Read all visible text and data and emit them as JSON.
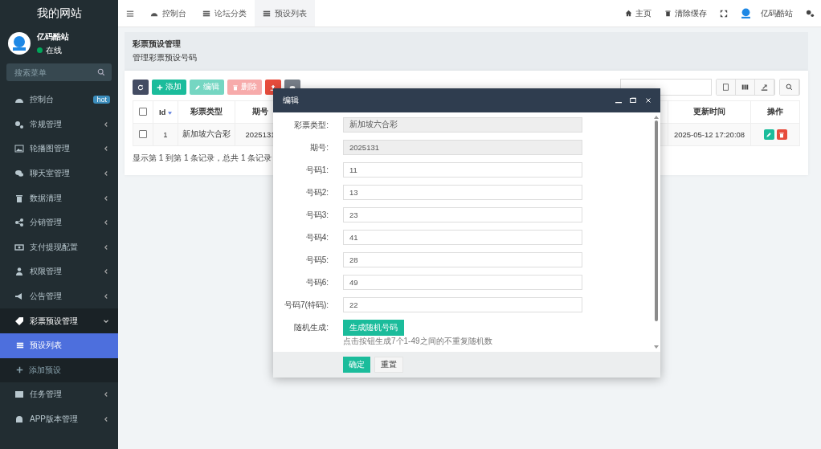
{
  "sidebar": {
    "title": "我的网站",
    "user": {
      "name": "亿码酷站",
      "status": "在线",
      "online": true
    },
    "search": {
      "placeholder": "搜索菜单"
    },
    "items": [
      {
        "label": "控制台",
        "badge": "hot",
        "expanded": false
      },
      {
        "label": "常规管理",
        "expanded": false
      },
      {
        "label": "轮播图管理",
        "expanded": false
      },
      {
        "label": "聊天室管理",
        "expanded": false
      },
      {
        "label": "数据清理",
        "expanded": false
      },
      {
        "label": "分销管理",
        "expanded": false
      },
      {
        "label": "支付提现配置",
        "expanded": false
      },
      {
        "label": "权限管理",
        "expanded": false
      },
      {
        "label": "公告管理",
        "expanded": false
      },
      {
        "label": "彩票预设管理",
        "expanded": true,
        "children": [
          {
            "label": "预设列表",
            "selected": true
          },
          {
            "label": "添加预设",
            "selected": false
          }
        ]
      },
      {
        "label": "任务管理",
        "expanded": false
      },
      {
        "label": "APP版本管理",
        "expanded": false
      }
    ]
  },
  "tabs": [
    {
      "label": "控制台",
      "selected": false
    },
    {
      "label": "论坛分类",
      "selected": false
    },
    {
      "label": "预设列表",
      "selected": true
    }
  ],
  "top_links": [
    {
      "kind": "home",
      "label": "主页"
    },
    {
      "kind": "cache",
      "label": "清除缓存"
    },
    {
      "kind": "fullscreen"
    },
    {
      "kind": "user",
      "label": "亿码酷站"
    },
    {
      "kind": "settings"
    }
  ],
  "panel": {
    "title": "彩票预设管理",
    "subtitle": "管理彩票预设号码"
  },
  "toolbar": [
    {
      "kind": "refresh",
      "disabled": false
    },
    {
      "kind": "add",
      "label": "添加",
      "disabled": false
    },
    {
      "kind": "edit",
      "label": "编辑",
      "disabled": true
    },
    {
      "kind": "delete",
      "label": "删除",
      "disabled": true
    },
    {
      "kind": "import",
      "disabled": false
    },
    {
      "kind": "view",
      "disabled": false
    }
  ],
  "table": {
    "all_checked": false,
    "columns": [
      "Id",
      "彩票类型",
      "期号",
      "更新时间",
      "操作"
    ],
    "rows": [
      {
        "checked": false,
        "cells": [
          "1",
          "新加坡六合彩",
          "2025131",
          "2025-05-12 17:20:08"
        ]
      }
    ],
    "footer": "显示第 1 到第 1 条记录，总共 1 条记录"
  },
  "modal": {
    "title": "编辑",
    "fields": [
      {
        "label": "彩票类型:",
        "value": "新加坡六合彩",
        "readonly": true
      },
      {
        "label": "期号:",
        "value": "2025131",
        "readonly": true
      },
      {
        "label": "号码1:",
        "value": "11",
        "readonly": false
      },
      {
        "label": "号码2:",
        "value": "13",
        "readonly": false
      },
      {
        "label": "号码3:",
        "value": "23",
        "readonly": false
      },
      {
        "label": "号码4:",
        "value": "41",
        "readonly": false
      },
      {
        "label": "号码5:",
        "value": "28",
        "readonly": false
      },
      {
        "label": "号码6:",
        "value": "49",
        "readonly": false
      },
      {
        "label": "号码7(特码):",
        "value": "22",
        "readonly": false
      }
    ],
    "random": {
      "label": "随机生成:",
      "button": "生成随机号码",
      "hint": "点击按钮生成7个1-49之间的不重复随机数"
    },
    "buttons": [
      {
        "kind": "primary",
        "label": "确定"
      },
      {
        "kind": "default",
        "label": "重置"
      }
    ]
  }
}
